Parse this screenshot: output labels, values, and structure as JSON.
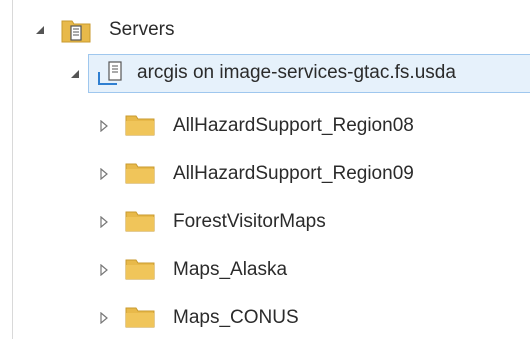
{
  "tree": {
    "root": {
      "label": "Servers",
      "icon": "server-folder-icon",
      "expanded": true
    },
    "server": {
      "label": "arcgis on image-services-gtac.fs.usda",
      "icon": "server-connection-icon",
      "expanded": true,
      "selected": true
    },
    "folders": [
      {
        "label": "AllHazardSupport_Region08",
        "icon": "folder-icon",
        "expanded": false
      },
      {
        "label": "AllHazardSupport_Region09",
        "icon": "folder-icon",
        "expanded": false
      },
      {
        "label": "ForestVisitorMaps",
        "icon": "folder-icon",
        "expanded": false
      },
      {
        "label": "Maps_Alaska",
        "icon": "folder-icon",
        "expanded": false
      },
      {
        "label": "Maps_CONUS",
        "icon": "folder-icon",
        "expanded": false
      }
    ]
  },
  "colors": {
    "selection_bg": "#e6f1fb",
    "selection_border": "#9fc7ee",
    "folder": "#e8b94a",
    "text": "#2b2b2b"
  }
}
